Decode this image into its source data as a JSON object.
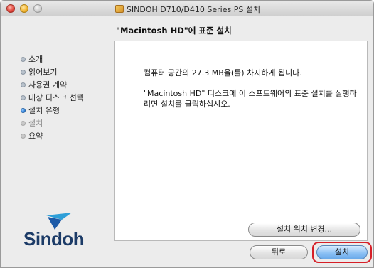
{
  "window": {
    "title": "SINDOH D710/D410 Series PS 설치"
  },
  "heading": "\"Macintosh HD\"에 표준 설치",
  "sidebar": {
    "steps": [
      {
        "label": "소개",
        "state": "done"
      },
      {
        "label": "읽어보기",
        "state": "done"
      },
      {
        "label": "사용권 계약",
        "state": "done"
      },
      {
        "label": "대상 디스크 선택",
        "state": "done"
      },
      {
        "label": "설치 유형",
        "state": "current"
      },
      {
        "label": "설치",
        "state": "pending"
      },
      {
        "label": "요약",
        "state": "pending"
      }
    ]
  },
  "content": {
    "line1": "컴퓨터 공간의 27.3 MB을(를) 차지하게 됩니다.",
    "line2": "\"Macintosh HD\" 디스크에 이 소프트웨어의 표준 설치를 실행하려면 설치를 클릭하십시오."
  },
  "buttons": {
    "change_location": "설치 위치 변경...",
    "back": "뒤로",
    "install": "설치"
  },
  "logo": {
    "text": "Sindoh"
  },
  "colors": {
    "highlight": "#d61f27",
    "logo_text": "#1c3b67",
    "current_step": "#2f7fd8"
  }
}
